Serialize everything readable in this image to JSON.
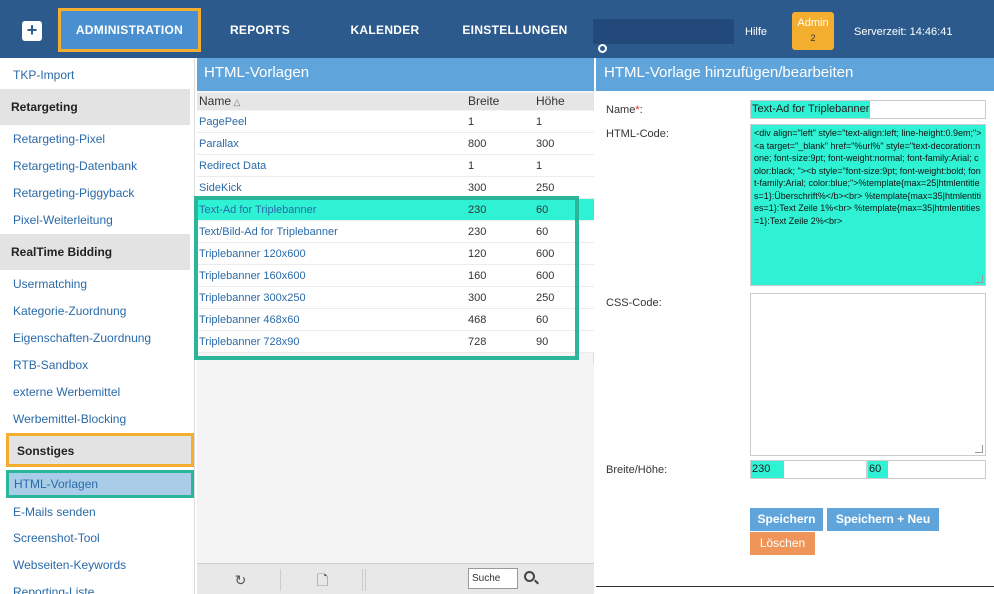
{
  "topbar": {
    "nav": {
      "administration": "ADMINISTRATION",
      "reports": "REPORTS",
      "kalender": "KALENDER",
      "einstellungen": "EINSTELLUNGEN"
    },
    "hilfe": "Hilfe",
    "admin_badge": "Admin",
    "admin_count": "2",
    "serverzeit": "Serverzeit: 14:46:41"
  },
  "sidebar": {
    "items": [
      {
        "label": "TKP-Import",
        "type": "item"
      },
      {
        "label": "Retargeting",
        "type": "header"
      },
      {
        "label": "Retargeting-Pixel",
        "type": "item"
      },
      {
        "label": "Retargeting-Datenbank",
        "type": "item"
      },
      {
        "label": "Retargeting-Piggyback",
        "type": "item"
      },
      {
        "label": "Pixel-Weiterleitung",
        "type": "item"
      },
      {
        "label": "RealTime Bidding",
        "type": "header"
      },
      {
        "label": "Usermatching",
        "type": "item"
      },
      {
        "label": "Kategorie-Zuordnung",
        "type": "item"
      },
      {
        "label": "Eigenschaften-Zuordnung",
        "type": "item"
      },
      {
        "label": "RTB-Sandbox",
        "type": "item"
      },
      {
        "label": "externe Werbemittel",
        "type": "item"
      },
      {
        "label": "Werbemittel-Blocking",
        "type": "item"
      },
      {
        "label": "Sonstiges",
        "type": "header"
      },
      {
        "label": "HTML-Vorlagen",
        "type": "item"
      },
      {
        "label": "E-Mails senden",
        "type": "item"
      },
      {
        "label": "Screenshot-Tool",
        "type": "item"
      },
      {
        "label": "Webseiten-Keywords",
        "type": "item"
      },
      {
        "label": "Reporting-Liste",
        "type": "item"
      }
    ]
  },
  "list": {
    "title": "HTML-Vorlagen",
    "columns": {
      "name": "Name",
      "sort_icon": "triangle-up-icon",
      "breite": "Breite",
      "hoehe": "Höhe"
    },
    "rows": [
      {
        "name": "PagePeel",
        "breite": "1",
        "hoehe": "1"
      },
      {
        "name": "Parallax",
        "breite": "800",
        "hoehe": "300"
      },
      {
        "name": "Redirect Data",
        "breite": "1",
        "hoehe": "1"
      },
      {
        "name": "SideKick",
        "breite": "300",
        "hoehe": "250"
      },
      {
        "name": "Text-Ad for Triplebanner",
        "breite": "230",
        "hoehe": "60"
      },
      {
        "name": "Text/Bild-Ad for Triplebanner",
        "breite": "230",
        "hoehe": "60"
      },
      {
        "name": "Triplebanner 120x600",
        "breite": "120",
        "hoehe": "600"
      },
      {
        "name": "Triplebanner 160x600",
        "breite": "160",
        "hoehe": "600"
      },
      {
        "name": "Triplebanner 300x250",
        "breite": "300",
        "hoehe": "250"
      },
      {
        "name": "Triplebanner 468x60",
        "breite": "468",
        "hoehe": "60"
      },
      {
        "name": "Triplebanner 728x90",
        "breite": "728",
        "hoehe": "90"
      }
    ],
    "footer": {
      "search_value": "Suche"
    }
  },
  "form": {
    "title": "HTML-Vorlage hinzufügen/bearbeiten",
    "name_label": "Name",
    "name_required": "*",
    "name_colon": ":",
    "name_value": "Text-Ad for Triplebanner",
    "html_label": "HTML-Code:",
    "html_value": "<div align=\"left\" style=\"text-align:left; line-height:0.9em;\"><a target=\"_blank\" href=\"%url%\" style=\"text-decoration:none; font-size:9pt; font-weight:normal; font-family:Arial; color:black; \"><b style=\"font-size:9pt; font-weight:bold; font-family:Arial; color:blue;\">%template{max=25|htmlentities=1}:Überschrift%</b><br> %template{max=35|htmlentities=1}:Text Zeile 1%<br> %template{max=35|htmlentities=1}:Text Zeile 2%<br>",
    "css_label": "CSS-Code:",
    "css_value": "",
    "size_label": "Breite/Höhe:",
    "breite_value": "230",
    "hoehe_value": "60",
    "save": "Speichern",
    "save_new": "Speichern + Neu",
    "delete": "Löschen"
  }
}
